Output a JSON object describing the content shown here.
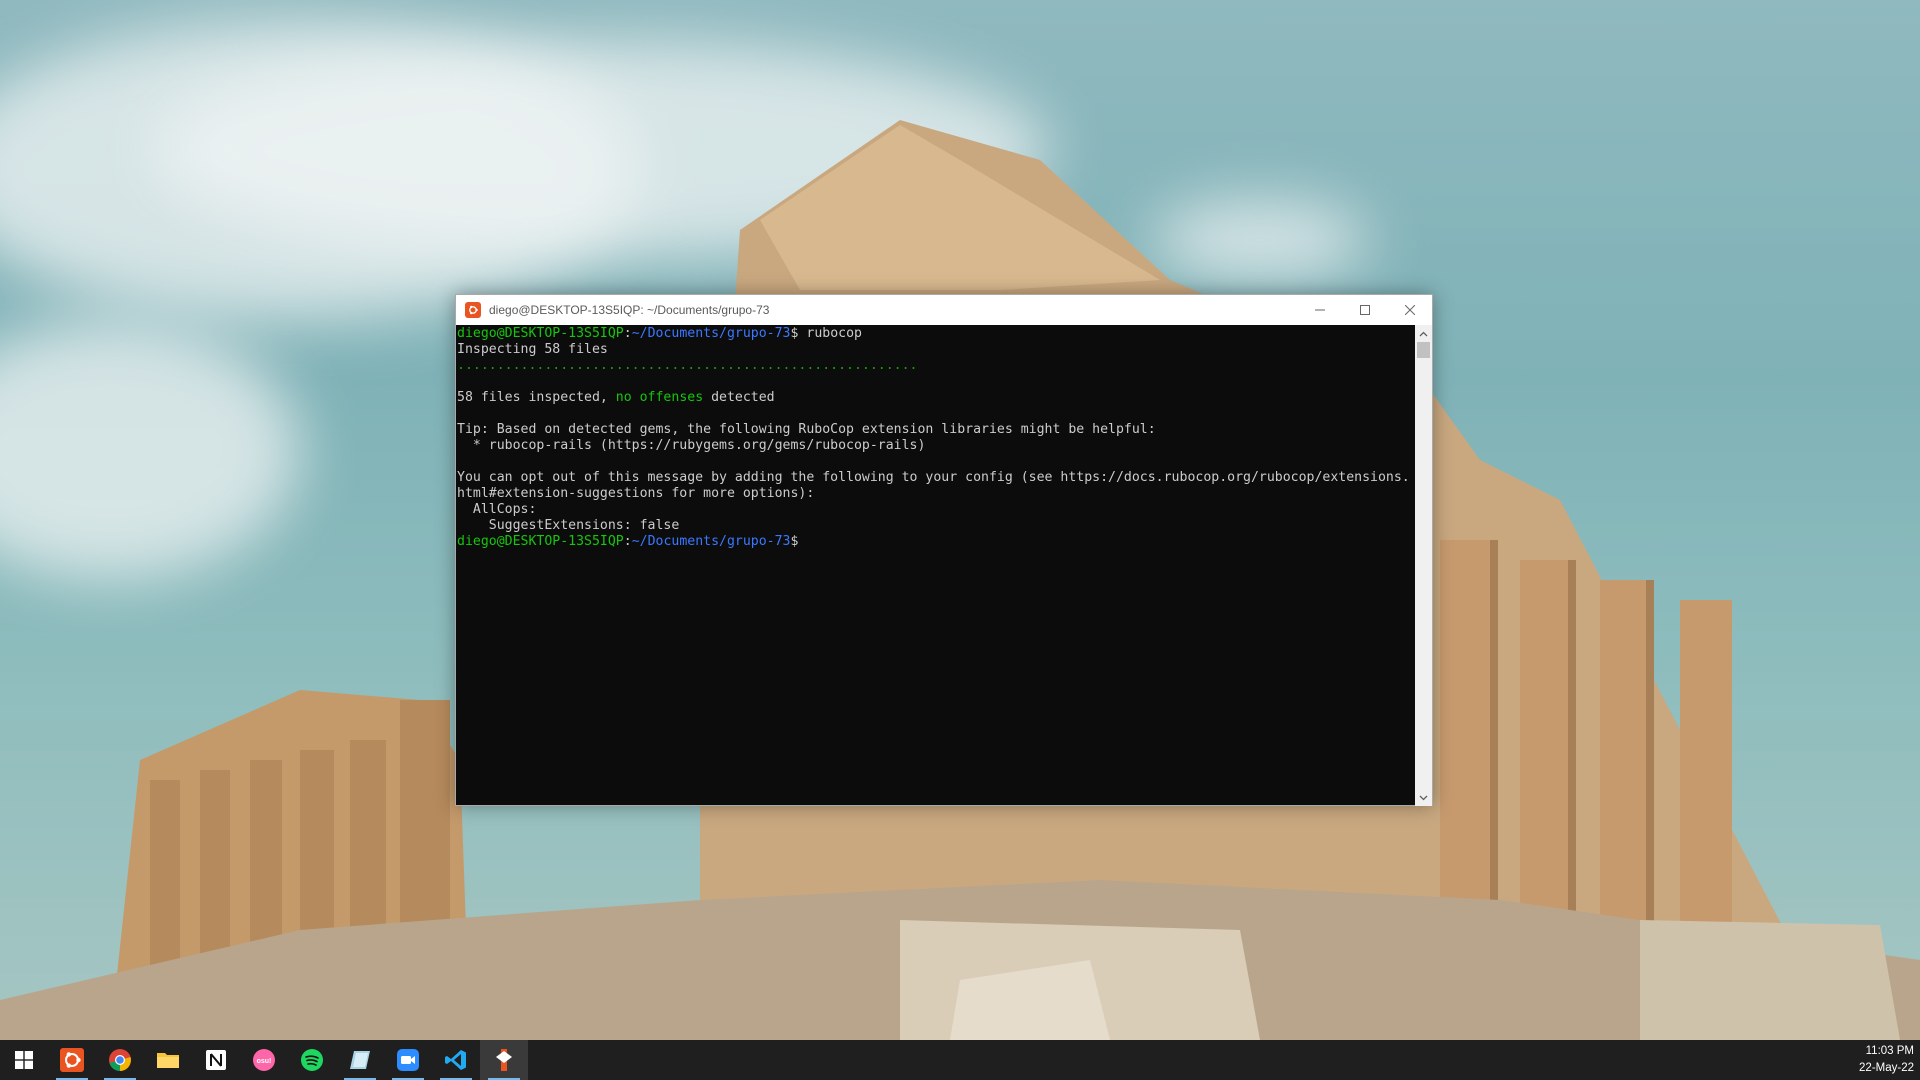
{
  "window": {
    "title": "diego@DESKTOP-13S5IQP: ~/Documents/grupo-73"
  },
  "terminal": {
    "prompt_user": "diego@DESKTOP-13S5IQP",
    "prompt_path": "~/Documents/grupo-73",
    "prompt_sign": "$",
    "command": " rubocop",
    "line_inspecting": "Inspecting 58 files",
    "progress_dots": "..........................................................",
    "summary_pre": "58 files inspected, ",
    "summary_ok": "no offenses",
    "summary_post": " detected",
    "tip_line": "Tip: Based on detected gems, the following RuboCop extension libraries might be helpful:",
    "tip_item": "  * rubocop-rails (https://rubygems.org/gems/rubocop-rails)",
    "optout_line1": "You can opt out of this message by adding the following to your config (see https://docs.rubocop.org/rubocop/extensions.",
    "optout_line2": "html#extension-suggestions for more options):",
    "cfg_line1": "  AllCops:",
    "cfg_line2": "    SuggestExtensions: false"
  },
  "taskbar": {
    "apps": [
      {
        "name": "start",
        "icon": "windows-icon"
      },
      {
        "name": "ubuntu",
        "icon": "ubuntu-icon"
      },
      {
        "name": "chrome",
        "icon": "chrome-icon"
      },
      {
        "name": "file-explorer",
        "icon": "folder-icon"
      },
      {
        "name": "notion",
        "icon": "notion-icon"
      },
      {
        "name": "osu",
        "icon": "osu-icon"
      },
      {
        "name": "spotify",
        "icon": "spotify-icon"
      },
      {
        "name": "app",
        "icon": "app-icon"
      },
      {
        "name": "zoom",
        "icon": "zoom-icon"
      },
      {
        "name": "vscode",
        "icon": "vscode-icon"
      },
      {
        "name": "active-app",
        "icon": "active-app-icon"
      }
    ],
    "clock_time": "11:03 PM",
    "clock_date": "22-May-22"
  },
  "colors": {
    "terminal_bg": "#0c0c0c",
    "prompt_green": "#16c60c",
    "prompt_blue": "#3b78ff",
    "taskbar_bg": "#1f1f1f"
  }
}
